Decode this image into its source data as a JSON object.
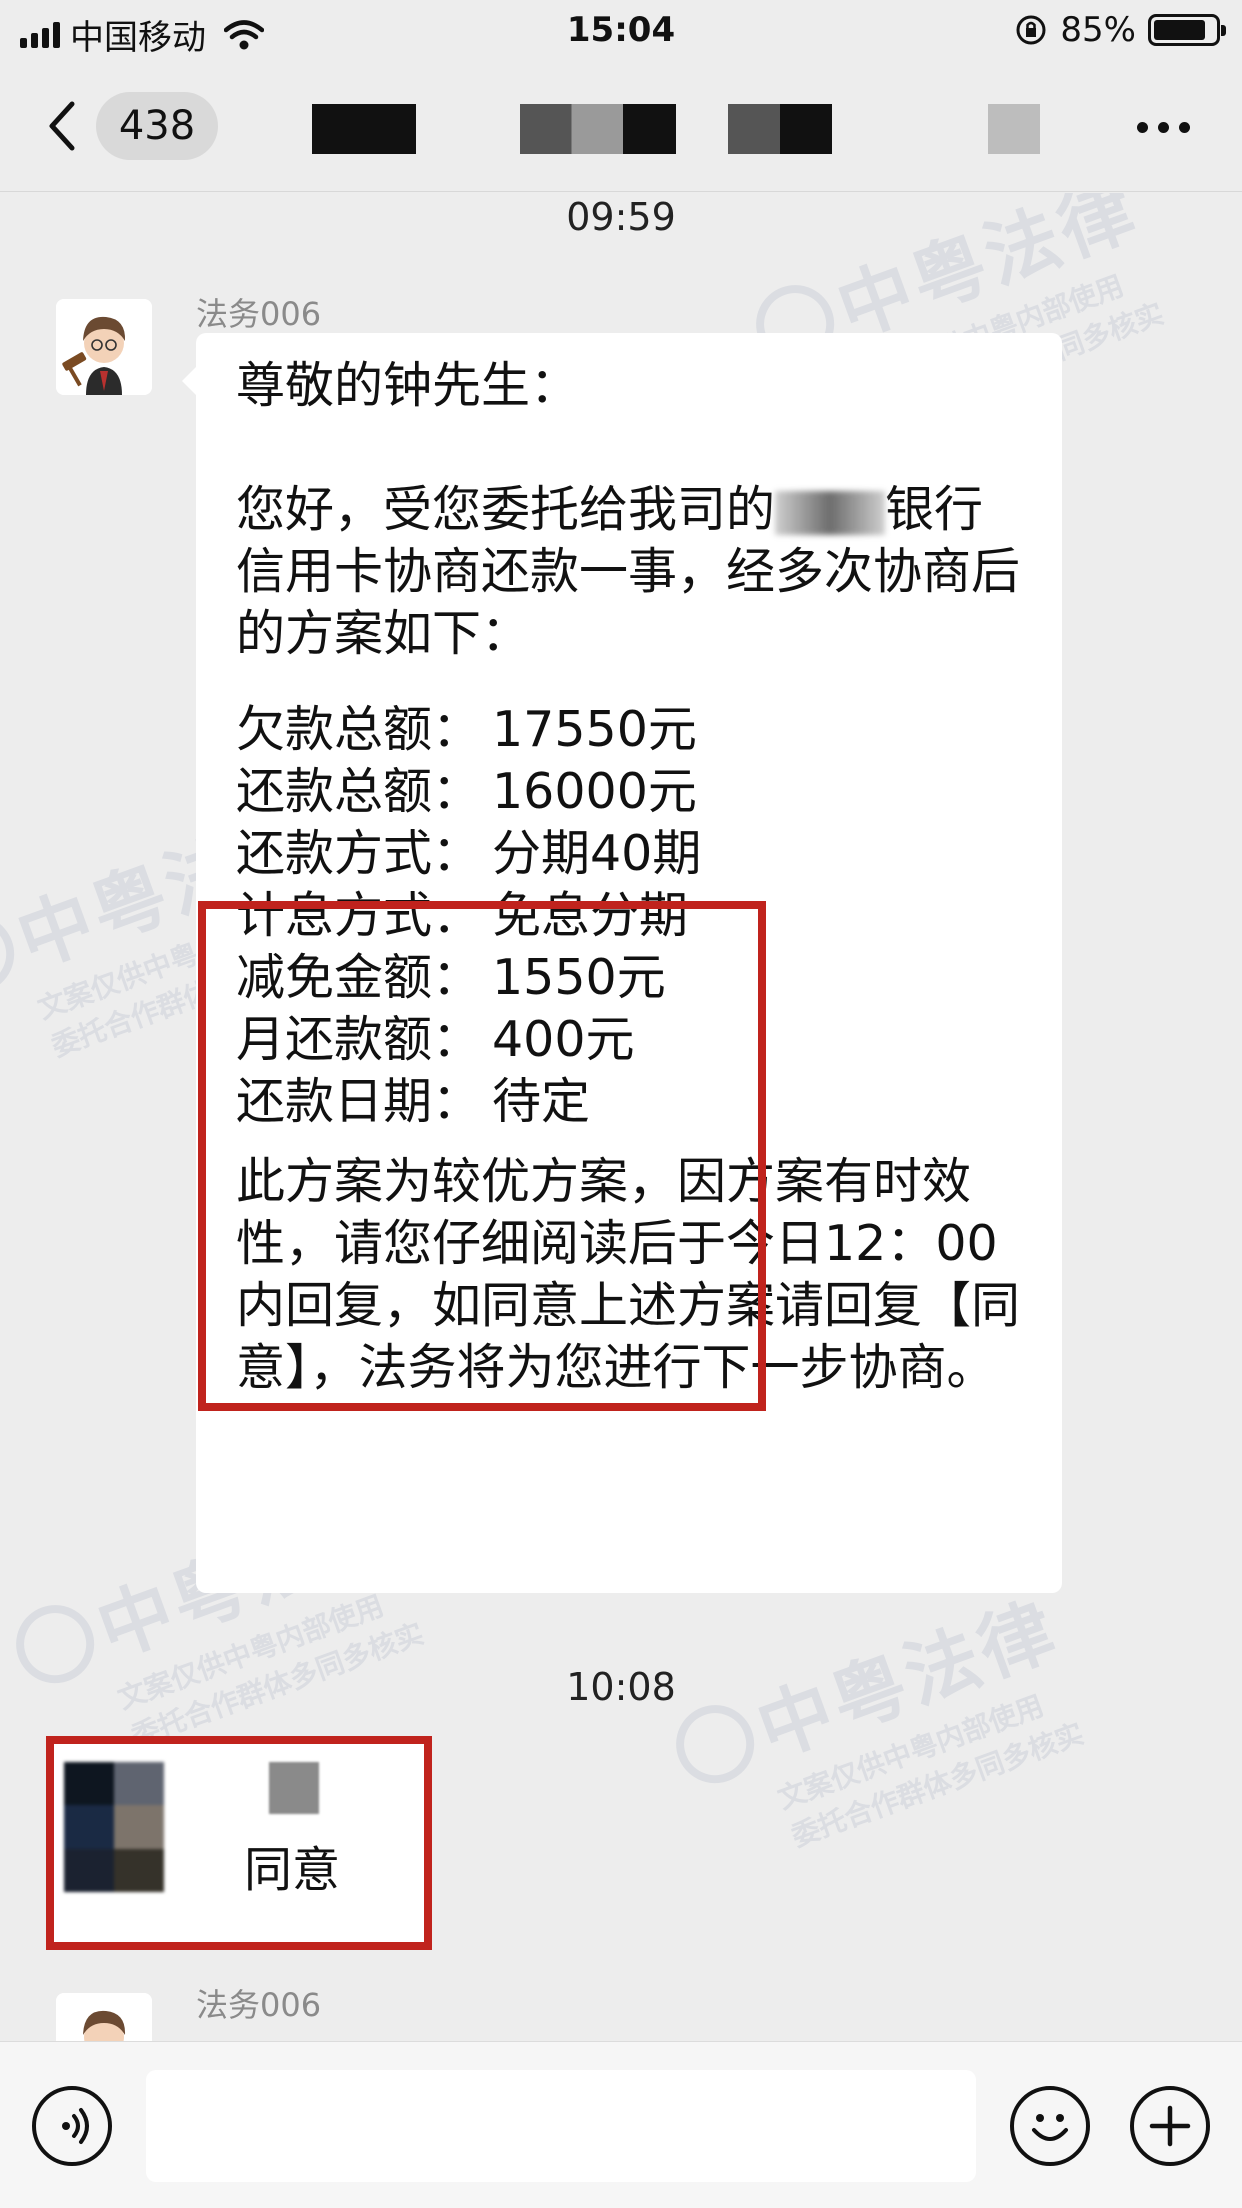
{
  "status_bar": {
    "carrier": "中国移动",
    "time": "15:04",
    "battery": "85%",
    "battery_level": 0.85
  },
  "nav": {
    "back_count": "438"
  },
  "chat": {
    "messages": [
      {
        "time": "09:59",
        "sender": "法务006",
        "greeting": "尊敬的钟先生：",
        "intro_before": "您好，受您委托给我司的",
        "intro_after": "银行信用卡协商还款一事，经多次协商后的方案如下：",
        "plan": [
          {
            "k": "欠款总额：",
            "v": "17550元"
          },
          {
            "k": "还款总额：",
            "v": "16000元"
          },
          {
            "k": "还款方式：",
            "v": "分期40期"
          },
          {
            "k": "计息方式：",
            "v": "免息分期"
          },
          {
            "k": "减免金额：",
            "v": "1550元"
          },
          {
            "k": "月还款额：",
            "v": "400元"
          },
          {
            "k": "还款日期：",
            "v": "待定"
          }
        ],
        "closing": "此方案为较优方案，因方案有时效性，请您仔细阅读后于今日12：00内回复，如同意上述方案请回复【同意】，法务将为您进行下一步协商。"
      },
      {
        "time": "10:08",
        "reply": "同意"
      },
      {
        "sender": "法务006"
      }
    ],
    "watermark": {
      "title": "中粤法律",
      "line1": "文案仅供中粤内部使用",
      "line2": "委托合作群体多同多核实"
    }
  },
  "colors": {
    "highlight_border": "#c0231d",
    "background": "#ededed",
    "bubble": "#ffffff"
  },
  "icons": [
    "signal-icon",
    "wifi-icon",
    "orientation-lock-icon",
    "battery-icon",
    "back-chevron-icon",
    "more-icon",
    "voice-icon",
    "emoji-icon",
    "plus-icon"
  ]
}
